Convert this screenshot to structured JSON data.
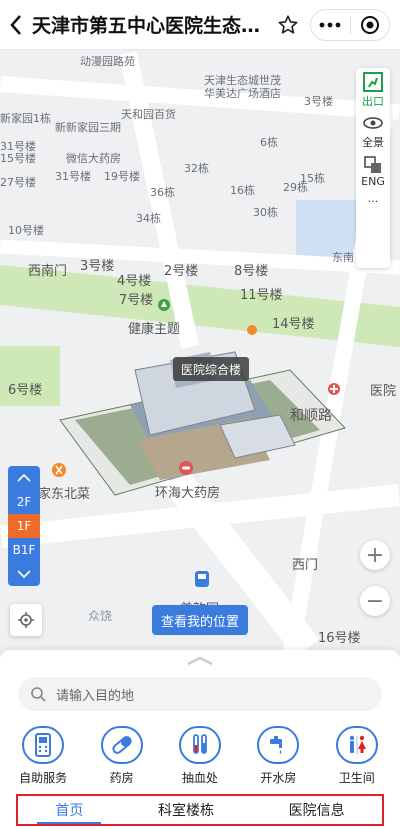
{
  "header": {
    "title": "天津市第五中心医院生态…",
    "icons": [
      "back-icon",
      "star-icon",
      "more-icon",
      "target-icon"
    ]
  },
  "map": {
    "labels": [
      {
        "text": "动漫园路苑"
      },
      {
        "text": "天津生态城世茂华美达广场酒店"
      },
      {
        "text": "新家园1栋"
      },
      {
        "text": "天和园百货"
      },
      {
        "text": "新新家园三期"
      },
      {
        "text": "3号楼"
      },
      {
        "text": "6栋"
      },
      {
        "text": "31号楼"
      },
      {
        "text": "微信大药房"
      },
      {
        "text": "15号楼"
      },
      {
        "text": "27号楼"
      },
      {
        "text": "31号楼"
      },
      {
        "text": "19号楼"
      },
      {
        "text": "32栋"
      },
      {
        "text": "36栋"
      },
      {
        "text": "16栋"
      },
      {
        "text": "15栋"
      },
      {
        "text": "10号楼"
      },
      {
        "text": "34栋"
      },
      {
        "text": "30栋"
      },
      {
        "text": "29栋"
      },
      {
        "text": "西南门"
      },
      {
        "text": "3号楼"
      },
      {
        "text": "4号楼"
      },
      {
        "text": "2号楼"
      },
      {
        "text": "8号楼"
      },
      {
        "text": "东南"
      },
      {
        "text": "7号楼"
      },
      {
        "text": "11号楼"
      },
      {
        "text": "健康主题"
      },
      {
        "text": "14号楼"
      },
      {
        "text": "6号楼"
      },
      {
        "text": "医院"
      },
      {
        "text": "和顺路"
      },
      {
        "text": "家东北菜"
      },
      {
        "text": "环海大药房"
      },
      {
        "text": "美韵园"
      },
      {
        "text": "西门"
      },
      {
        "text": "16号楼"
      },
      {
        "text": "众饶"
      }
    ],
    "building_tag": "医院综合楼",
    "locate_button": "查看我的位置",
    "floors": [
      {
        "label": "2F",
        "active": false
      },
      {
        "label": "1F",
        "active": true
      },
      {
        "label": "B1F",
        "active": false
      }
    ],
    "zoom_in": "+",
    "zoom_out": "−"
  },
  "toolbar": {
    "exit_label": "出口",
    "panorama_label": "全景",
    "eng_label": "ENG",
    "more_label": "···"
  },
  "panel": {
    "search_placeholder": "请输入目的地",
    "services": [
      {
        "label": "自助服务",
        "icon": "kiosk-icon"
      },
      {
        "label": "药房",
        "icon": "pill-icon"
      },
      {
        "label": "抽血处",
        "icon": "blood-tube-icon"
      },
      {
        "label": "开水房",
        "icon": "water-tap-icon"
      },
      {
        "label": "卫生间",
        "icon": "restroom-icon"
      }
    ],
    "tabs": [
      {
        "label": "首页",
        "active": true
      },
      {
        "label": "科室楼栋",
        "active": false
      },
      {
        "label": "医院信息",
        "active": false
      }
    ]
  },
  "colors": {
    "accent": "#3a7bdf",
    "active_floor": "#f06a2a",
    "exit_green": "#1aa14a",
    "highlight_border": "#e0202a"
  }
}
